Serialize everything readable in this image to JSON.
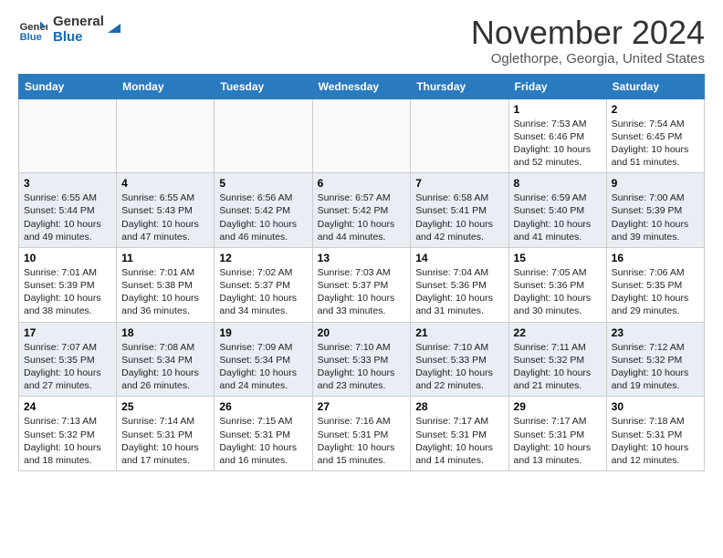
{
  "logo": {
    "line1": "General",
    "line2": "Blue"
  },
  "title": "November 2024",
  "subtitle": "Oglethorpe, Georgia, United States",
  "weekdays": [
    "Sunday",
    "Monday",
    "Tuesday",
    "Wednesday",
    "Thursday",
    "Friday",
    "Saturday"
  ],
  "weeks": [
    [
      {
        "day": "",
        "info": ""
      },
      {
        "day": "",
        "info": ""
      },
      {
        "day": "",
        "info": ""
      },
      {
        "day": "",
        "info": ""
      },
      {
        "day": "",
        "info": ""
      },
      {
        "day": "1",
        "info": "Sunrise: 7:53 AM\nSunset: 6:46 PM\nDaylight: 10 hours\nand 52 minutes."
      },
      {
        "day": "2",
        "info": "Sunrise: 7:54 AM\nSunset: 6:45 PM\nDaylight: 10 hours\nand 51 minutes."
      }
    ],
    [
      {
        "day": "3",
        "info": "Sunrise: 6:55 AM\nSunset: 5:44 PM\nDaylight: 10 hours\nand 49 minutes."
      },
      {
        "day": "4",
        "info": "Sunrise: 6:55 AM\nSunset: 5:43 PM\nDaylight: 10 hours\nand 47 minutes."
      },
      {
        "day": "5",
        "info": "Sunrise: 6:56 AM\nSunset: 5:42 PM\nDaylight: 10 hours\nand 46 minutes."
      },
      {
        "day": "6",
        "info": "Sunrise: 6:57 AM\nSunset: 5:42 PM\nDaylight: 10 hours\nand 44 minutes."
      },
      {
        "day": "7",
        "info": "Sunrise: 6:58 AM\nSunset: 5:41 PM\nDaylight: 10 hours\nand 42 minutes."
      },
      {
        "day": "8",
        "info": "Sunrise: 6:59 AM\nSunset: 5:40 PM\nDaylight: 10 hours\nand 41 minutes."
      },
      {
        "day": "9",
        "info": "Sunrise: 7:00 AM\nSunset: 5:39 PM\nDaylight: 10 hours\nand 39 minutes."
      }
    ],
    [
      {
        "day": "10",
        "info": "Sunrise: 7:01 AM\nSunset: 5:39 PM\nDaylight: 10 hours\nand 38 minutes."
      },
      {
        "day": "11",
        "info": "Sunrise: 7:01 AM\nSunset: 5:38 PM\nDaylight: 10 hours\nand 36 minutes."
      },
      {
        "day": "12",
        "info": "Sunrise: 7:02 AM\nSunset: 5:37 PM\nDaylight: 10 hours\nand 34 minutes."
      },
      {
        "day": "13",
        "info": "Sunrise: 7:03 AM\nSunset: 5:37 PM\nDaylight: 10 hours\nand 33 minutes."
      },
      {
        "day": "14",
        "info": "Sunrise: 7:04 AM\nSunset: 5:36 PM\nDaylight: 10 hours\nand 31 minutes."
      },
      {
        "day": "15",
        "info": "Sunrise: 7:05 AM\nSunset: 5:36 PM\nDaylight: 10 hours\nand 30 minutes."
      },
      {
        "day": "16",
        "info": "Sunrise: 7:06 AM\nSunset: 5:35 PM\nDaylight: 10 hours\nand 29 minutes."
      }
    ],
    [
      {
        "day": "17",
        "info": "Sunrise: 7:07 AM\nSunset: 5:35 PM\nDaylight: 10 hours\nand 27 minutes."
      },
      {
        "day": "18",
        "info": "Sunrise: 7:08 AM\nSunset: 5:34 PM\nDaylight: 10 hours\nand 26 minutes."
      },
      {
        "day": "19",
        "info": "Sunrise: 7:09 AM\nSunset: 5:34 PM\nDaylight: 10 hours\nand 24 minutes."
      },
      {
        "day": "20",
        "info": "Sunrise: 7:10 AM\nSunset: 5:33 PM\nDaylight: 10 hours\nand 23 minutes."
      },
      {
        "day": "21",
        "info": "Sunrise: 7:10 AM\nSunset: 5:33 PM\nDaylight: 10 hours\nand 22 minutes."
      },
      {
        "day": "22",
        "info": "Sunrise: 7:11 AM\nSunset: 5:32 PM\nDaylight: 10 hours\nand 21 minutes."
      },
      {
        "day": "23",
        "info": "Sunrise: 7:12 AM\nSunset: 5:32 PM\nDaylight: 10 hours\nand 19 minutes."
      }
    ],
    [
      {
        "day": "24",
        "info": "Sunrise: 7:13 AM\nSunset: 5:32 PM\nDaylight: 10 hours\nand 18 minutes."
      },
      {
        "day": "25",
        "info": "Sunrise: 7:14 AM\nSunset: 5:31 PM\nDaylight: 10 hours\nand 17 minutes."
      },
      {
        "day": "26",
        "info": "Sunrise: 7:15 AM\nSunset: 5:31 PM\nDaylight: 10 hours\nand 16 minutes."
      },
      {
        "day": "27",
        "info": "Sunrise: 7:16 AM\nSunset: 5:31 PM\nDaylight: 10 hours\nand 15 minutes."
      },
      {
        "day": "28",
        "info": "Sunrise: 7:17 AM\nSunset: 5:31 PM\nDaylight: 10 hours\nand 14 minutes."
      },
      {
        "day": "29",
        "info": "Sunrise: 7:17 AM\nSunset: 5:31 PM\nDaylight: 10 hours\nand 13 minutes."
      },
      {
        "day": "30",
        "info": "Sunrise: 7:18 AM\nSunset: 5:31 PM\nDaylight: 10 hours\nand 12 minutes."
      }
    ]
  ]
}
